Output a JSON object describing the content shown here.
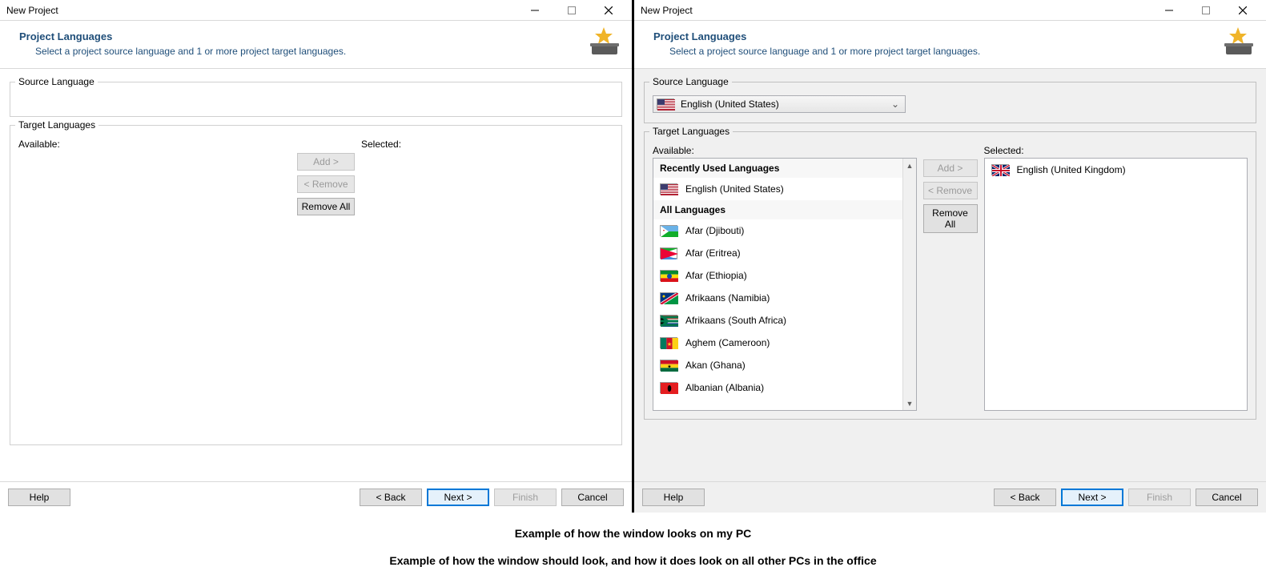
{
  "left": {
    "title": "New Project",
    "banner_title": "Project Languages",
    "banner_sub": "Select a project source language and 1 or more project target languages.",
    "source_label": "Source Language",
    "target_label": "Target Languages",
    "available_label": "Available:",
    "selected_label": "Selected:",
    "add_label": "Add >",
    "remove_label": "< Remove",
    "removeall_label": "Remove All",
    "help_label": "Help",
    "back_label": "< Back",
    "next_label": "Next >",
    "finish_label": "Finish",
    "cancel_label": "Cancel"
  },
  "right": {
    "title": "New Project",
    "banner_title": "Project Languages",
    "banner_sub": "Select a project source language and 1 or more project target languages.",
    "source_label": "Source Language",
    "source_value": "English (United States)",
    "target_label": "Target Languages",
    "available_label": "Available:",
    "selected_label": "Selected:",
    "add_label": "Add >",
    "remove_label": "< Remove",
    "removeall_label": "Remove All",
    "recent_hdr": "Recently Used Languages",
    "all_hdr": "All Languages",
    "recent_items": [
      {
        "name": "English (United States)",
        "flag": "us"
      }
    ],
    "all_items": [
      {
        "name": "Afar (Djibouti)",
        "flag": "dj"
      },
      {
        "name": "Afar (Eritrea)",
        "flag": "er"
      },
      {
        "name": "Afar (Ethiopia)",
        "flag": "et"
      },
      {
        "name": "Afrikaans (Namibia)",
        "flag": "na"
      },
      {
        "name": "Afrikaans (South Africa)",
        "flag": "za"
      },
      {
        "name": "Aghem (Cameroon)",
        "flag": "cm"
      },
      {
        "name": "Akan (Ghana)",
        "flag": "gh"
      },
      {
        "name": "Albanian (Albania)",
        "flag": "al"
      }
    ],
    "selected_items": [
      {
        "name": "English (United Kingdom)",
        "flag": "gb"
      }
    ],
    "help_label": "Help",
    "back_label": "< Back",
    "next_label": "Next >",
    "finish_label": "Finish",
    "cancel_label": "Cancel"
  },
  "caption_left": "Example of how the window looks on my PC",
  "caption_right": "Example of how the window should look, and how it does look on all other PCs in the office"
}
